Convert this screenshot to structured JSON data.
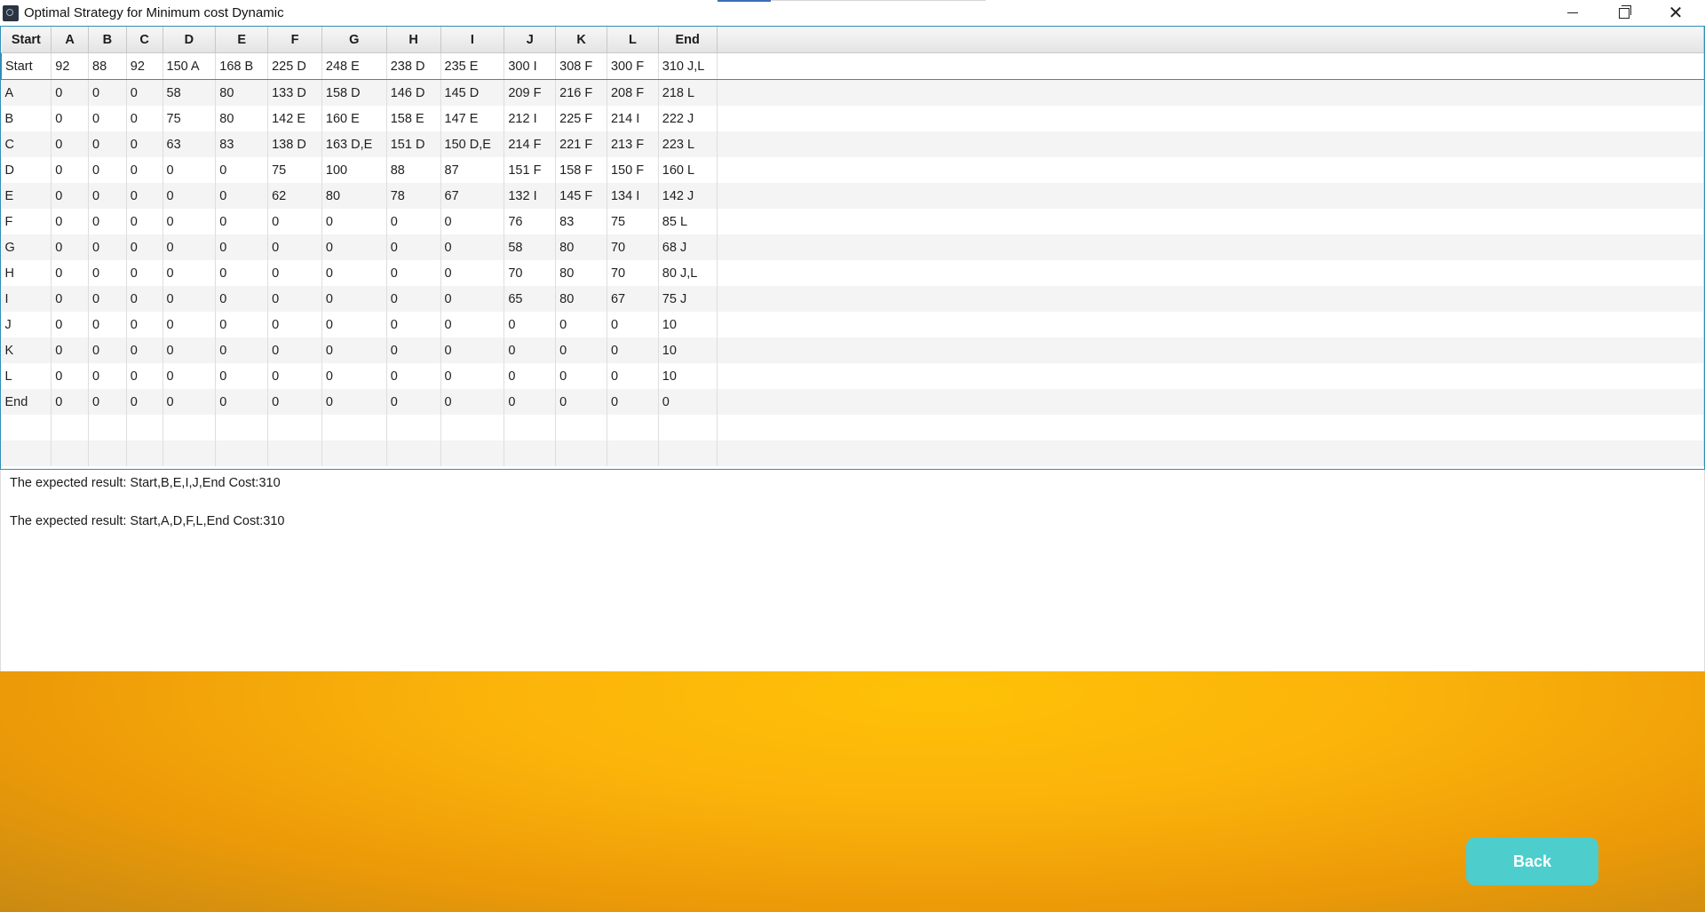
{
  "window": {
    "title": "Optimal Strategy for Minimum cost Dynamic"
  },
  "table": {
    "columns": [
      "Start",
      "A",
      "B",
      "C",
      "D",
      "E",
      "F",
      "G",
      "H",
      "I",
      "J",
      "K",
      "L",
      "End"
    ],
    "rows": [
      [
        "Start",
        "92",
        "88",
        "92",
        "150 A",
        "168 B",
        "225 D",
        "248 E",
        "238 D",
        "235 E",
        "300 I",
        "308 F",
        "300 F",
        "310 J,L"
      ],
      [
        "A",
        "0",
        "0",
        "0",
        "58",
        "80",
        "133 D",
        "158 D",
        "146 D",
        "145 D",
        "209 F",
        "216 F",
        "208 F",
        "218 L"
      ],
      [
        "B",
        "0",
        "0",
        "0",
        "75",
        "80",
        "142 E",
        "160 E",
        "158 E",
        "147 E",
        "212 I",
        "225 F",
        "214 I",
        "222 J"
      ],
      [
        "C",
        "0",
        "0",
        "0",
        "63",
        "83",
        "138 D",
        "163 D,E",
        "151 D",
        "150 D,E",
        "214 F",
        "221 F",
        "213 F",
        "223 L"
      ],
      [
        "D",
        "0",
        "0",
        "0",
        "0",
        "0",
        "75",
        "100",
        "88",
        "87",
        "151 F",
        "158 F",
        "150 F",
        "160 L"
      ],
      [
        "E",
        "0",
        "0",
        "0",
        "0",
        "0",
        "62",
        "80",
        "78",
        "67",
        "132 I",
        "145 F",
        "134 I",
        "142 J"
      ],
      [
        "F",
        "0",
        "0",
        "0",
        "0",
        "0",
        "0",
        "0",
        "0",
        "0",
        "76",
        "83",
        "75",
        "85 L"
      ],
      [
        "G",
        "0",
        "0",
        "0",
        "0",
        "0",
        "0",
        "0",
        "0",
        "0",
        "58",
        "80",
        "70",
        "68 J"
      ],
      [
        "H",
        "0",
        "0",
        "0",
        "0",
        "0",
        "0",
        "0",
        "0",
        "0",
        "70",
        "80",
        "70",
        "80 J,L"
      ],
      [
        "I",
        "0",
        "0",
        "0",
        "0",
        "0",
        "0",
        "0",
        "0",
        "0",
        "65",
        "80",
        "67",
        "75 J"
      ],
      [
        "J",
        "0",
        "0",
        "0",
        "0",
        "0",
        "0",
        "0",
        "0",
        "0",
        "0",
        "0",
        "0",
        "10"
      ],
      [
        "K",
        "0",
        "0",
        "0",
        "0",
        "0",
        "0",
        "0",
        "0",
        "0",
        "0",
        "0",
        "0",
        "10"
      ],
      [
        "L",
        "0",
        "0",
        "0",
        "0",
        "0",
        "0",
        "0",
        "0",
        "0",
        "0",
        "0",
        "0",
        "10"
      ],
      [
        "End",
        "0",
        "0",
        "0",
        "0",
        "0",
        "0",
        "0",
        "0",
        "0",
        "0",
        "0",
        "0",
        "0"
      ]
    ]
  },
  "results": {
    "line1": "The expected result:  Start,B,E,I,J,End Cost:310",
    "line2": "The expected result:  Start,A,D,F,L,End Cost:310"
  },
  "buttons": {
    "back": "Back"
  },
  "colors": {
    "accent": "#2e8fb8",
    "back_button": "#4dcdcc",
    "background_gradient": "#fbb30a"
  }
}
